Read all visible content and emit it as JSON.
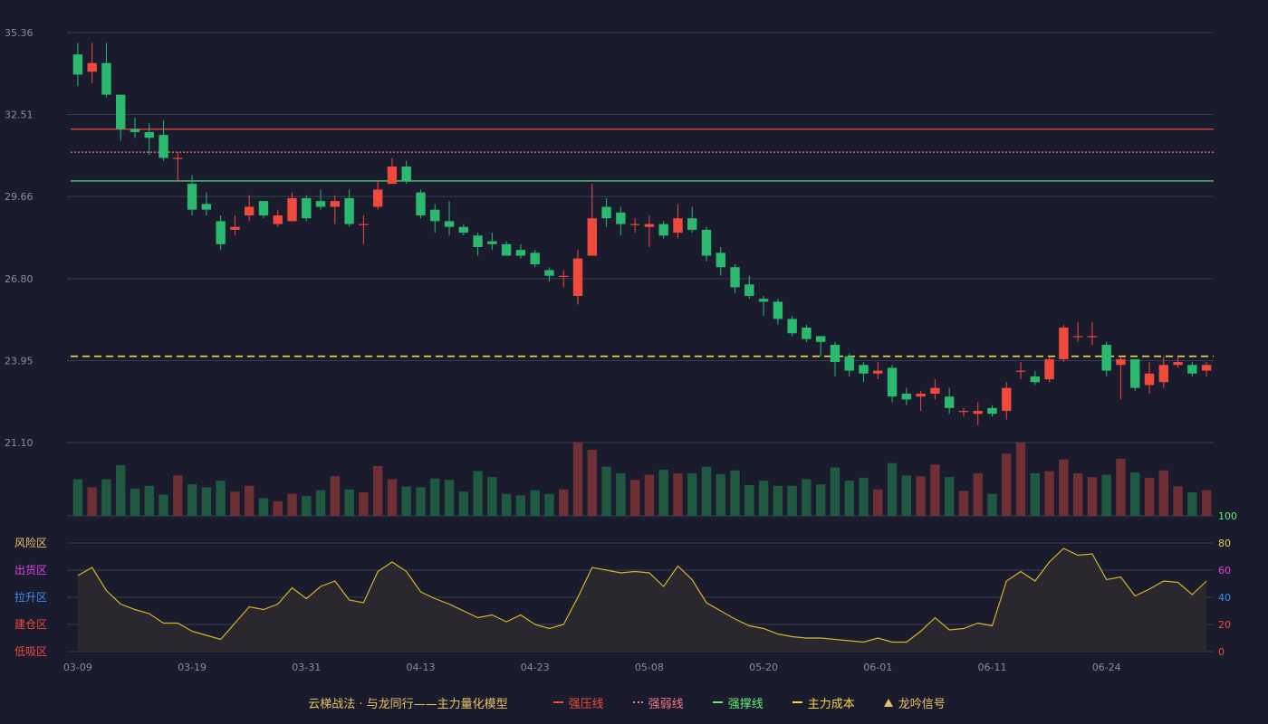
{
  "chart_data": {
    "type": "candlestick",
    "title": "",
    "price_axis": {
      "ticks": [
        35.36,
        32.51,
        29.66,
        26.8,
        23.95,
        21.1
      ],
      "ylim": [
        21.1,
        35.36
      ]
    },
    "x_tick_labels": [
      "03-09",
      "03-19",
      "03-31",
      "04-13",
      "04-23",
      "05-08",
      "05-20",
      "06-01",
      "06-11",
      "06-24"
    ],
    "x_tick_indices": [
      0,
      8,
      16,
      24,
      32,
      40,
      48,
      56,
      64,
      72
    ],
    "reference_lines": {
      "strong_pressure": 32.0,
      "strong_weak": 31.2,
      "strong_support": 30.2,
      "main_cost": 24.1
    },
    "candles": [
      [
        34.6,
        33.9,
        35.0,
        33.5
      ],
      [
        34.0,
        34.3,
        35.0,
        33.6
      ],
      [
        34.3,
        33.2,
        35.0,
        33.1
      ],
      [
        33.2,
        32.0,
        33.2,
        31.6
      ],
      [
        32.0,
        31.9,
        32.4,
        31.7
      ],
      [
        31.9,
        31.7,
        32.2,
        31.1
      ],
      [
        31.8,
        31.0,
        32.3,
        30.9
      ],
      [
        31.0,
        31.0,
        31.2,
        30.2
      ],
      [
        30.1,
        29.2,
        30.4,
        29.0
      ],
      [
        29.4,
        29.2,
        29.8,
        29.0
      ],
      [
        28.8,
        28.0,
        29.0,
        27.8
      ],
      [
        28.5,
        28.6,
        29.0,
        28.3
      ],
      [
        29.0,
        29.3,
        29.7,
        28.8
      ],
      [
        29.5,
        29.0,
        29.5,
        28.9
      ],
      [
        28.7,
        29.0,
        29.2,
        28.6
      ],
      [
        28.8,
        29.6,
        29.8,
        28.8
      ],
      [
        29.6,
        28.9,
        29.7,
        28.8
      ],
      [
        29.5,
        29.3,
        29.9,
        29.2
      ],
      [
        29.3,
        29.5,
        29.7,
        28.7
      ],
      [
        29.6,
        28.7,
        29.9,
        28.6
      ],
      [
        28.7,
        28.7,
        29.0,
        28.0
      ],
      [
        29.3,
        29.9,
        30.2,
        29.2
      ],
      [
        30.1,
        30.7,
        31.0,
        30.1
      ],
      [
        30.7,
        30.2,
        30.9,
        30.1
      ],
      [
        29.8,
        29.0,
        29.9,
        28.9
      ],
      [
        29.2,
        28.8,
        29.4,
        28.4
      ],
      [
        28.8,
        28.6,
        29.5,
        28.3
      ],
      [
        28.6,
        28.4,
        28.7,
        28.3
      ],
      [
        28.3,
        27.9,
        28.4,
        27.6
      ],
      [
        28.1,
        28.0,
        28.4,
        27.8
      ],
      [
        28.0,
        27.6,
        28.1,
        27.6
      ],
      [
        27.8,
        27.6,
        28.0,
        27.5
      ],
      [
        27.7,
        27.3,
        27.8,
        27.2
      ],
      [
        27.1,
        26.9,
        27.2,
        26.7
      ],
      [
        26.9,
        26.9,
        27.1,
        26.5
      ],
      [
        26.2,
        27.5,
        27.8,
        25.9
      ],
      [
        27.6,
        28.9,
        30.1,
        27.6
      ],
      [
        29.3,
        28.9,
        29.6,
        28.6
      ],
      [
        29.1,
        28.7,
        29.3,
        28.3
      ],
      [
        28.7,
        28.7,
        28.9,
        28.4
      ],
      [
        28.6,
        28.7,
        29.0,
        27.9
      ],
      [
        28.7,
        28.3,
        28.8,
        28.2
      ],
      [
        28.4,
        28.9,
        29.4,
        28.2
      ],
      [
        28.9,
        28.5,
        29.3,
        28.4
      ],
      [
        28.5,
        27.6,
        28.6,
        27.4
      ],
      [
        27.7,
        27.2,
        27.9,
        26.9
      ],
      [
        27.2,
        26.5,
        27.3,
        26.3
      ],
      [
        26.6,
        26.2,
        26.9,
        26.1
      ],
      [
        26.1,
        26.0,
        26.2,
        25.5
      ],
      [
        26.0,
        25.4,
        26.1,
        25.2
      ],
      [
        25.4,
        24.9,
        25.5,
        24.8
      ],
      [
        25.1,
        24.7,
        25.2,
        24.6
      ],
      [
        24.8,
        24.6,
        24.8,
        24.1
      ],
      [
        24.5,
        23.9,
        24.6,
        23.4
      ],
      [
        24.1,
        23.6,
        24.2,
        23.4
      ],
      [
        23.8,
        23.5,
        23.9,
        23.2
      ],
      [
        23.5,
        23.6,
        23.9,
        23.3
      ],
      [
        23.7,
        22.7,
        23.8,
        22.5
      ],
      [
        22.8,
        22.6,
        23.0,
        22.4
      ],
      [
        22.7,
        22.8,
        22.9,
        22.2
      ],
      [
        22.8,
        23.0,
        23.3,
        22.6
      ],
      [
        22.7,
        22.3,
        23.0,
        22.1
      ],
      [
        22.2,
        22.2,
        22.3,
        22.0
      ],
      [
        22.1,
        22.2,
        22.5,
        21.7
      ],
      [
        22.3,
        22.1,
        22.4,
        22.0
      ],
      [
        22.2,
        23.0,
        23.2,
        21.9
      ],
      [
        23.6,
        23.6,
        23.9,
        23.3
      ],
      [
        23.4,
        23.2,
        23.6,
        23.1
      ],
      [
        23.3,
        24.0,
        24.1,
        23.2
      ],
      [
        24.0,
        25.1,
        25.2,
        23.9
      ],
      [
        24.8,
        24.8,
        25.3,
        24.6
      ],
      [
        24.8,
        24.8,
        25.3,
        24.5
      ],
      [
        24.5,
        23.6,
        24.6,
        23.4
      ],
      [
        23.8,
        24.0,
        24.1,
        22.6
      ],
      [
        24.0,
        23.0,
        24.0,
        22.9
      ],
      [
        23.1,
        23.5,
        23.9,
        22.8
      ],
      [
        23.2,
        23.8,
        24.1,
        23.0
      ],
      [
        23.8,
        23.9,
        24.1,
        23.7
      ],
      [
        23.8,
        23.5,
        23.9,
        23.4
      ],
      [
        23.6,
        23.8,
        23.9,
        23.4
      ]
    ],
    "volumes": [
      50,
      39,
      50,
      69,
      37,
      41,
      29,
      55,
      43,
      39,
      48,
      33,
      41,
      24,
      20,
      30,
      27,
      35,
      54,
      36,
      32,
      68,
      50,
      40,
      39,
      51,
      49,
      33,
      61,
      53,
      30,
      28,
      35,
      30,
      36,
      100,
      90,
      67,
      58,
      49,
      56,
      63,
      58,
      58,
      67,
      57,
      62,
      42,
      48,
      41,
      41,
      50,
      43,
      66,
      48,
      52,
      36,
      72,
      55,
      54,
      70,
      53,
      34,
      58,
      30,
      85,
      100,
      58,
      61,
      77,
      58,
      53,
      56,
      78,
      59,
      52,
      62,
      40,
      32,
      35
    ],
    "oscillator": {
      "ylim": [
        0,
        100
      ],
      "ticks": [
        0,
        20,
        40,
        60,
        80,
        100
      ],
      "zone_labels": [
        "风险区",
        "出货区",
        "拉升区",
        "建仓区",
        "低吸区"
      ],
      "zone_colors": [
        "#e8c462",
        "#e040e0",
        "#3d8ff0",
        "#ef4a3c",
        "#ef4a3c"
      ],
      "tick_colors": [
        "#ef4a3c",
        "#ef4a3c",
        "#3d8ff0",
        "#e040e0",
        "#e8c462",
        "#5df07a"
      ],
      "values": [
        56,
        62,
        45,
        35,
        31,
        28,
        21,
        21,
        15,
        12,
        9,
        21,
        33,
        31,
        35,
        47,
        39,
        48,
        52,
        38,
        36,
        59,
        66,
        59,
        44,
        39,
        35,
        30,
        25,
        27,
        22,
        27,
        20,
        17,
        20,
        40,
        62,
        60,
        58,
        59,
        58,
        48,
        63,
        53,
        36,
        30,
        24,
        19,
        17,
        13,
        11,
        10,
        10,
        9,
        8,
        7,
        10,
        7,
        7,
        15,
        25,
        16,
        17,
        21,
        19,
        52,
        59,
        52,
        66,
        76,
        71,
        72,
        53,
        55,
        41,
        46,
        52,
        51,
        42,
        52
      ]
    },
    "colors": {
      "up": "#ef4a3c",
      "down": "#2ab96e",
      "vol_up": "#6e2f35",
      "vol_down": "#1f5940",
      "grid": "#3a3c52",
      "axis_text": "#8a8d99",
      "osc_line": "#d6b42a",
      "osc_fill": "#2c2a2f"
    },
    "legend": {
      "title": "云梯战法 · 与龙同行——主力量化模型",
      "items": [
        "强压线",
        "强弱线",
        "强撑线",
        "主力成本",
        "龙吟信号"
      ]
    }
  }
}
